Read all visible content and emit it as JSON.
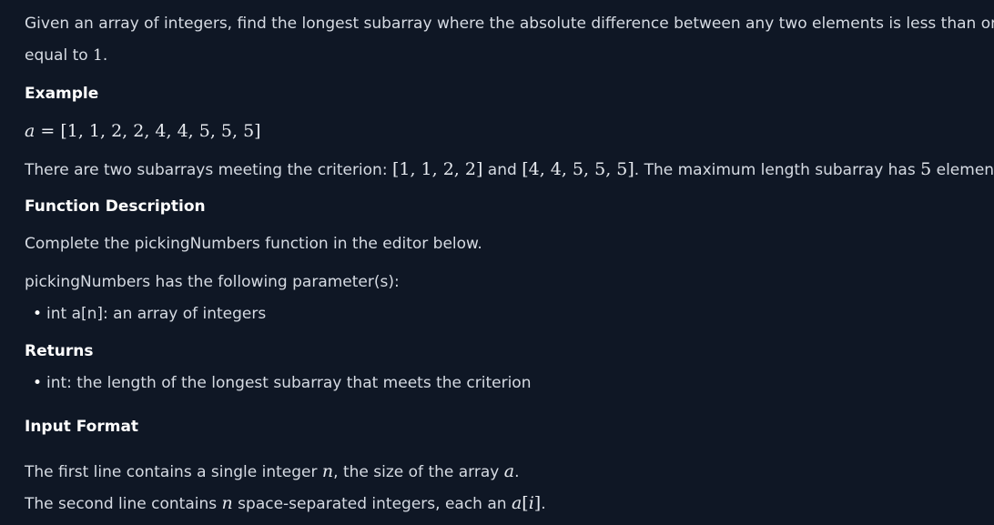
{
  "problem": {
    "intro_line1": "Given an array of integers, find the longest subarray where the absolute difference between any two elements is less than or",
    "intro_line2_text": "equal to ",
    "intro_line2_value": "1",
    "intro_line2_end": ".",
    "example_heading": "Example",
    "example_var": "a",
    "example_eq": " = ",
    "example_array": "[1, 1, 2, 2, 4, 4, 5, 5, 5]",
    "criterion_text1": "There are two subarrays meeting the criterion: ",
    "criterion_sub1": "[1, 1, 2, 2]",
    "criterion_and": " and ",
    "criterion_sub2": "[4, 4, 5, 5, 5]",
    "criterion_text2": ". The maximum length subarray has ",
    "criterion_count": "5",
    "criterion_text3": " elements.",
    "function_heading": "Function Description",
    "function_desc": "Complete the pickingNumbers function in the editor below.",
    "params_intro": "pickingNumbers has the following parameter(s):",
    "params": [
      "int a[n]: an array of integers"
    ],
    "returns_heading": "Returns",
    "returns": [
      "int: the length of the longest subarray that meets the criterion"
    ],
    "input_heading": "Input Format",
    "input_line1_a": "The first line contains a single integer ",
    "input_line1_n": "n",
    "input_line1_b": ", the size of the array ",
    "input_line1_a_var": "a",
    "input_line1_end": ".",
    "input_line2_a": "The second line contains ",
    "input_line2_n": "n",
    "input_line2_b": " space-separated integers, each an ",
    "input_line2_expr_a": "a",
    "input_line2_expr_open": "[",
    "input_line2_expr_i": "i",
    "input_line2_expr_close": "]",
    "input_line2_end": "."
  },
  "colors": {
    "background": "#0f1725",
    "text": "#d6dbe3",
    "heading": "#ffffff"
  }
}
